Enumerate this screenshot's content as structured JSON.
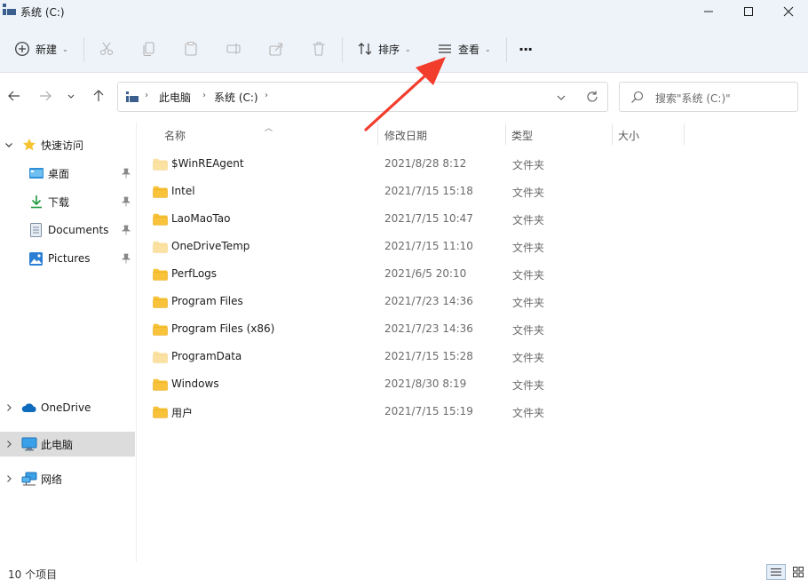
{
  "window": {
    "title": "系统 (C:)"
  },
  "toolbar": {
    "new_label": "新建",
    "sort_label": "排序",
    "view_label": "查看",
    "more_label": "···"
  },
  "address": {
    "crumbs": [
      "此电脑",
      "系统 (C:)"
    ]
  },
  "search": {
    "placeholder": "搜索\"系统 (C:)\""
  },
  "sidebar": {
    "quick_access": "快速访问",
    "items": [
      {
        "label": "桌面",
        "icon": "desktop-icon",
        "pinned": true
      },
      {
        "label": "下载",
        "icon": "download-icon",
        "pinned": true
      },
      {
        "label": "Documents",
        "icon": "documents-icon",
        "pinned": true
      },
      {
        "label": "Pictures",
        "icon": "pictures-icon",
        "pinned": true
      }
    ],
    "onedrive": "OneDrive",
    "this_pc": "此电脑",
    "network": "网络"
  },
  "columns": {
    "name": "名称",
    "date": "修改日期",
    "type": "类型",
    "size": "大小"
  },
  "files": [
    {
      "name": "$WinREAgent",
      "date": "2021/8/28 8:12",
      "type": "文件夹",
      "faded": true
    },
    {
      "name": "Intel",
      "date": "2021/7/15 15:18",
      "type": "文件夹",
      "faded": false
    },
    {
      "name": "LaoMaoTao",
      "date": "2021/7/15 10:47",
      "type": "文件夹",
      "faded": false
    },
    {
      "name": "OneDriveTemp",
      "date": "2021/7/15 11:10",
      "type": "文件夹",
      "faded": true
    },
    {
      "name": "PerfLogs",
      "date": "2021/6/5 20:10",
      "type": "文件夹",
      "faded": false
    },
    {
      "name": "Program Files",
      "date": "2021/7/23 14:36",
      "type": "文件夹",
      "faded": false
    },
    {
      "name": "Program Files (x86)",
      "date": "2021/7/23 14:36",
      "type": "文件夹",
      "faded": false
    },
    {
      "name": "ProgramData",
      "date": "2021/7/15 15:28",
      "type": "文件夹",
      "faded": true
    },
    {
      "name": "Windows",
      "date": "2021/8/30 8:19",
      "type": "文件夹",
      "faded": false
    },
    {
      "name": "用户",
      "date": "2021/7/15 15:19",
      "type": "文件夹",
      "faded": false
    }
  ],
  "status": {
    "item_count": "10 个项目"
  },
  "colors": {
    "folder": "#f8c33a",
    "folder_faded": "#fbe2a3",
    "accent": "#0067c0",
    "arrow": "#f23c2c"
  }
}
